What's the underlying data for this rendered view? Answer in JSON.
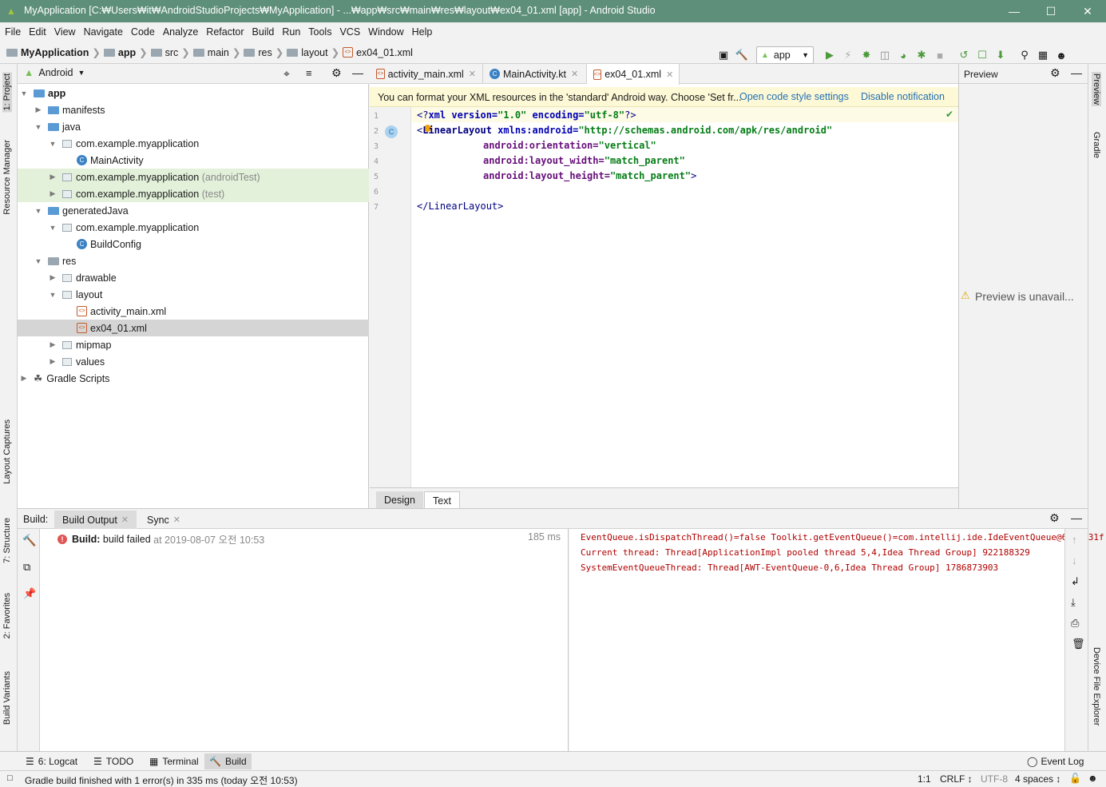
{
  "window": {
    "title": "MyApplication [C:₩Users₩it₩AndroidStudioProjects₩MyApplication] - ...₩app₩src₩main₩res₩layout₩ex04_01.xml [app] - Android Studio",
    "minimize": "—",
    "maximize": "☐",
    "close": "✕"
  },
  "menu": [
    "File",
    "Edit",
    "View",
    "Navigate",
    "Code",
    "Analyze",
    "Refactor",
    "Build",
    "Run",
    "Tools",
    "VCS",
    "Window",
    "Help"
  ],
  "breadcrumb": [
    "MyApplication",
    "app",
    "src",
    "main",
    "res",
    "layout",
    "ex04_01.xml"
  ],
  "toolbar": {
    "run_config": "app"
  },
  "left_tools": {
    "project": "1: Project",
    "resource_manager": "Resource Manager",
    "layout_captures": "Layout Captures",
    "structure": "7: Structure",
    "favorites": "2: Favorites",
    "build_variants": "Build Variants"
  },
  "right_tools": {
    "preview": "Preview",
    "gradle": "Gradle",
    "device_file_explorer": "Device File Explorer"
  },
  "project": {
    "view": "Android",
    "tree": [
      {
        "label": "app",
        "extra": ""
      },
      {
        "label": "manifests",
        "extra": ""
      },
      {
        "label": "java",
        "extra": ""
      },
      {
        "label": "com.example.myapplication",
        "extra": ""
      },
      {
        "label": "MainActivity",
        "extra": ""
      },
      {
        "label": "com.example.myapplication",
        "extra": "(androidTest)"
      },
      {
        "label": "com.example.myapplication",
        "extra": "(test)"
      },
      {
        "label": "generatedJava",
        "extra": ""
      },
      {
        "label": "com.example.myapplication",
        "extra": ""
      },
      {
        "label": "BuildConfig",
        "extra": ""
      },
      {
        "label": "res",
        "extra": ""
      },
      {
        "label": "drawable",
        "extra": ""
      },
      {
        "label": "layout",
        "extra": ""
      },
      {
        "label": "activity_main.xml",
        "extra": ""
      },
      {
        "label": "ex04_01.xml",
        "extra": ""
      },
      {
        "label": "mipmap",
        "extra": ""
      },
      {
        "label": "values",
        "extra": ""
      },
      {
        "label": "Gradle Scripts",
        "extra": ""
      }
    ]
  },
  "editor": {
    "tabs": [
      "activity_main.xml",
      "MainActivity.kt",
      "ex04_01.xml"
    ],
    "notification": {
      "text": "You can format your XML resources in the 'standard' Android way. Choose 'Set fr...",
      "link1": "Open code style settings",
      "link2": "Disable notification"
    },
    "line_numbers": [
      "1",
      "2",
      "3",
      "4",
      "5",
      "6",
      "7"
    ],
    "code": {
      "l1_a": "<?",
      "l1_b": "xml ",
      "l1_c": "version=",
      "l1_d": "\"1.0\"",
      "l1_e": " encoding=",
      "l1_f": "\"utf-8\"",
      "l1_g": "?>",
      "l2_a": "<",
      "l2_b": "LinearLayout ",
      "l2_c": "xmlns:android=",
      "l2_d": "\"http://schemas.android.com/apk/res/android\"",
      "l3_a": "android:orientation=",
      "l3_b": "\"vertical\"",
      "l4_a": "android:layout_width=",
      "l4_b": "\"match_parent\"",
      "l5_a": "android:layout_height=",
      "l5_b": "\"match_parent\"",
      "l5_c": ">",
      "l7": "</LinearLayout>"
    },
    "design_tabs": [
      "Design",
      "Text"
    ]
  },
  "preview": {
    "title": "Preview",
    "message": "Preview is unavail..."
  },
  "build": {
    "label": "Build:",
    "tabs": [
      "Build Output",
      "Sync"
    ],
    "result_bold": "Build:",
    "result_text": "build failed",
    "result_time": "at 2019-08-07 오전 10:53",
    "duration": "185 ms",
    "console": [
      "EventQueue.isDispatchThread()=false Toolkit.getEventQueue()=com.intellij.ide.IdeEventQueue@63c1731f",
      "Current thread: Thread[ApplicationImpl pooled thread 5,4,Idea Thread Group] 922188329",
      "SystemEventQueueThread: Thread[AWT-EventQueue-0,6,Idea Thread Group] 1786873903"
    ]
  },
  "bottom_tabs": {
    "logcat": "6: Logcat",
    "todo": "TODO",
    "terminal": "Terminal",
    "build": "Build",
    "event_log": "Event Log"
  },
  "status": {
    "message": "Gradle build finished with 1 error(s) in 335 ms (today 오전 10:53)",
    "position": "1:1",
    "line_sep": "CRLF ↕",
    "encoding": "UTF-8",
    "indent": "4 spaces ↕"
  },
  "colors": {
    "titlebar": "#5e8f7a",
    "android_green": "#78c257",
    "error_red": "#e05555",
    "link": "#2470b3"
  }
}
